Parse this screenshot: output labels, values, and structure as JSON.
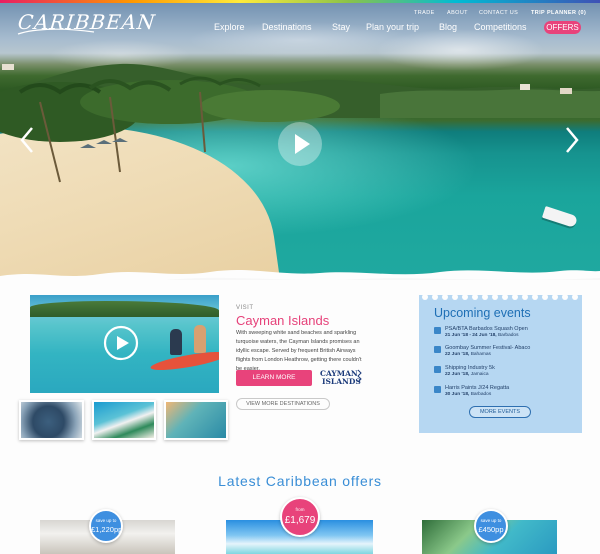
{
  "brand": {
    "logo_text": "CARIBBEAN"
  },
  "top_links": [
    {
      "label": "TRADE"
    },
    {
      "label": "ABOUT"
    },
    {
      "label": "CONTACT US"
    },
    {
      "label": "TRIP PLANNER (0)"
    }
  ],
  "nav": {
    "items": [
      {
        "label": "Explore"
      },
      {
        "label": "Destinations"
      },
      {
        "label": "Stay"
      },
      {
        "label": "Plan your trip"
      },
      {
        "label": "Blog"
      },
      {
        "label": "Competitions"
      }
    ],
    "offers_label": "OFFERS"
  },
  "feature": {
    "visit_label": "VISIT",
    "title": "Cayman Islands",
    "body": "With sweeping white sand beaches and sparkling turquoise waters, the Cayman Islands promises an idyllic escape. Served by frequent British Airways flights from London Heathrow, getting there couldn't be easier.",
    "learn_more": "LEARN MORE",
    "view_more": "VIEW MORE DESTINATIONS",
    "partner_logo_text": "CAYMAN ISLANDS"
  },
  "events": {
    "title": "Upcoming events",
    "items": [
      {
        "title": "PSA/BTA Barbados Squash Open",
        "date": "21 Jun '18 - 24 Jun '18,",
        "place": "Barbados"
      },
      {
        "title": "Goombay Summer Festival- Abaco",
        "date": "22 Jun '18,",
        "place": "Bahamas"
      },
      {
        "title": "Shipping Industry 5k",
        "date": "22 Jun '18,",
        "place": "Jamaica"
      },
      {
        "title": "Harris Paints J/24 Regatta",
        "date": "30 Jun '18,",
        "place": "Barbados"
      }
    ],
    "more_label": "MORE EVENTS"
  },
  "offers": {
    "heading": "Latest Caribbean offers",
    "cards": [
      {
        "badge_small": "save up to",
        "badge_value": "£1,220pp",
        "badge_color": "#3e8fe0"
      },
      {
        "badge_small": "from",
        "badge_value": "£1,679",
        "badge_color": "#e8437b"
      },
      {
        "badge_small": "save up to",
        "badge_value": "£450pp",
        "badge_color": "#3e8fe0"
      }
    ]
  },
  "colors": {
    "accent_pink": "#e8437b",
    "accent_blue": "#3a8ed6",
    "events_bg": "#b6d7f2"
  }
}
